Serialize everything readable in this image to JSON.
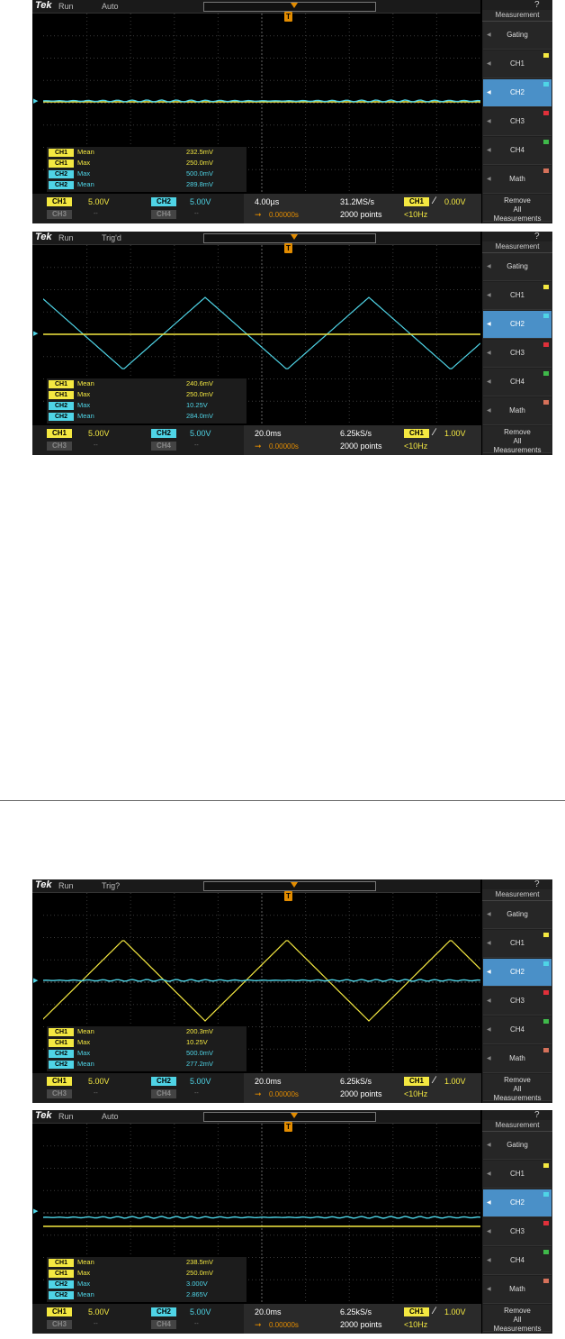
{
  "common": {
    "brand": "Tek",
    "run": "Run",
    "side_title": "Measurement",
    "help": "?",
    "menu": [
      {
        "label": "Gating",
        "swatch": null
      },
      {
        "label": "CH1",
        "swatch": "#f4e841"
      },
      {
        "label": "CH2",
        "swatch": "#4fd4e6"
      },
      {
        "label": "CH3",
        "swatch": "#e0303a"
      },
      {
        "label": "CH4",
        "swatch": "#3fb94a"
      },
      {
        "label": "Math",
        "swatch": "#d6715a"
      }
    ],
    "remove": [
      "Remove",
      "All",
      "Measurements"
    ],
    "ch_labels": [
      "CH1",
      "CH2",
      "CH3",
      "CH4"
    ],
    "dashes": "--",
    "colors": {
      "ch1": "#f4e841",
      "ch2": "#4fd4e6",
      "trigger": "#e38c00"
    }
  },
  "panels": [
    {
      "trig": "Auto",
      "meas": [
        {
          "ch": "CH1",
          "type": "Mean",
          "value": "232.5mV"
        },
        {
          "ch": "CH1",
          "type": "Max",
          "value": "250.0mV"
        },
        {
          "ch": "CH2",
          "type": "Max",
          "value": "500.0mV"
        },
        {
          "ch": "CH2",
          "type": "Mean",
          "value": "289.8mV"
        }
      ],
      "ch1_scale": "5.00V",
      "ch2_scale": "5.00V",
      "timebase": "4.00µs",
      "delay": "0.00000s",
      "sample_rate": "31.2MS/s",
      "points": "2000 points",
      "trig_level": "0.00V",
      "freq": "<10Hz",
      "waves": {
        "ch1": "flat",
        "ch2": "flat"
      }
    },
    {
      "trig": "Trig'd",
      "meas": [
        {
          "ch": "CH1",
          "type": "Mean",
          "value": "240.6mV"
        },
        {
          "ch": "CH1",
          "type": "Max",
          "value": "250.0mV"
        },
        {
          "ch": "CH2",
          "type": "Max",
          "value": "10.25V"
        },
        {
          "ch": "CH2",
          "type": "Mean",
          "value": "284.0mV"
        }
      ],
      "ch1_scale": "5.00V",
      "ch2_scale": "5.00V",
      "timebase": "20.0ms",
      "delay": "0.00000s",
      "sample_rate": "6.25kS/s",
      "points": "2000 points",
      "trig_level": "1.00V",
      "freq": "<10Hz",
      "waves": {
        "ch1": "flat",
        "ch2": "triangle"
      }
    },
    {
      "trig": "Trig?",
      "meas": [
        {
          "ch": "CH1",
          "type": "Mean",
          "value": "200.3mV"
        },
        {
          "ch": "CH1",
          "type": "Max",
          "value": "10.25V"
        },
        {
          "ch": "CH2",
          "type": "Max",
          "value": "500.0mV"
        },
        {
          "ch": "CH2",
          "type": "Mean",
          "value": "277.2mV"
        }
      ],
      "ch1_scale": "5.00V",
      "ch2_scale": "5.00V",
      "timebase": "20.0ms",
      "delay": "0.00000s",
      "sample_rate": "6.25kS/s",
      "points": "2000 points",
      "trig_level": "1.00V",
      "freq": "<10Hz",
      "waves": {
        "ch1": "triangle",
        "ch2": "flat"
      }
    },
    {
      "trig": "Auto",
      "meas": [
        {
          "ch": "CH1",
          "type": "Mean",
          "value": "238.5mV"
        },
        {
          "ch": "CH1",
          "type": "Max",
          "value": "250.0mV"
        },
        {
          "ch": "CH2",
          "type": "Max",
          "value": "3.000V"
        },
        {
          "ch": "CH2",
          "type": "Mean",
          "value": "2.865V"
        }
      ],
      "ch1_scale": "5.00V",
      "ch2_scale": "5.00V",
      "timebase": "20.0ms",
      "delay": "0.00000s",
      "sample_rate": "6.25kS/s",
      "points": "2000 points",
      "trig_level": "1.00V",
      "freq": "<10Hz",
      "waves": {
        "ch1": "flat",
        "ch2": "flat-high"
      }
    }
  ]
}
